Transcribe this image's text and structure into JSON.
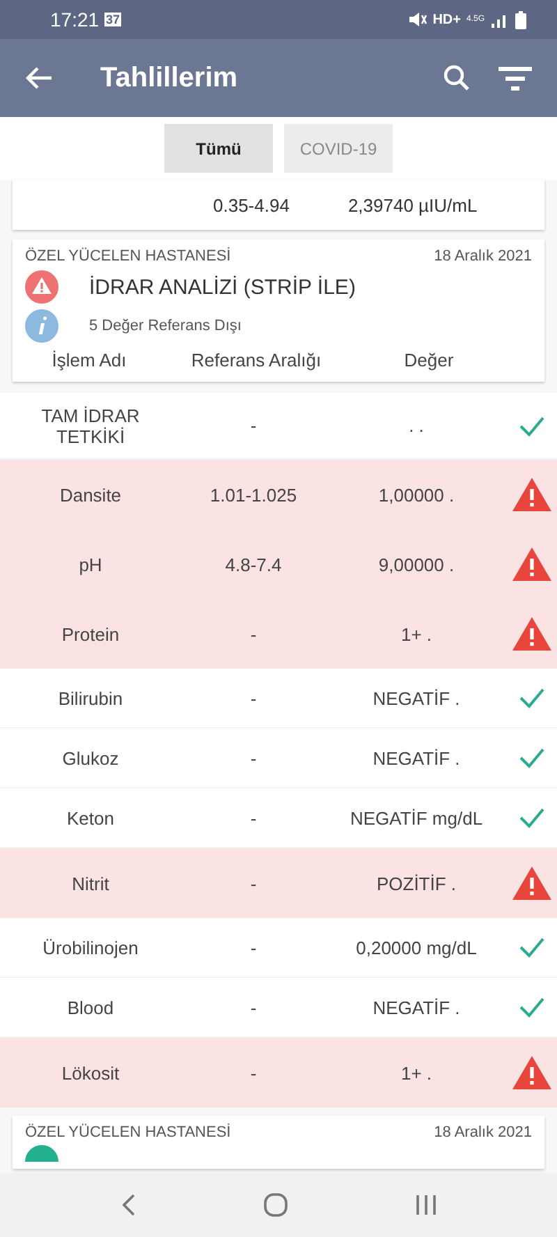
{
  "status_bar": {
    "time": "17:21",
    "calendar_day": "37",
    "network": "HD+",
    "network_type": "4.5G"
  },
  "app_bar": {
    "title": "Tahlillerim"
  },
  "tabs": [
    {
      "label": "Tümü",
      "selected": true
    },
    {
      "label": "COVID-19",
      "selected": false
    }
  ],
  "previous_card": {
    "reference": "0.35-4.94",
    "value": "2,39740 µIU/mL"
  },
  "card": {
    "hospital": "ÖZEL YÜCELEN HASTANESİ",
    "date": "18 Aralık 2021",
    "title": "İDRAR ANALİZİ (STRİP İLE)",
    "note": "5 Değer Referans Dışı",
    "columns": [
      "İşlem Adı",
      "Referans Aralığı",
      "Değer"
    ]
  },
  "rows": [
    {
      "name": "TAM İDRAR TETKİKİ",
      "reference": "-",
      "value": ". .",
      "abnormal": false
    },
    {
      "name": "Dansite",
      "reference": "1.01-1.025",
      "value": "1,00000 .",
      "abnormal": true
    },
    {
      "name": "pH",
      "reference": "4.8-7.4",
      "value": "9,00000 .",
      "abnormal": true
    },
    {
      "name": "Protein",
      "reference": "-",
      "value": "1+ .",
      "abnormal": true
    },
    {
      "name": "Bilirubin",
      "reference": "-",
      "value": "NEGATİF .",
      "abnormal": false
    },
    {
      "name": "Glukoz",
      "reference": "-",
      "value": "NEGATİF .",
      "abnormal": false
    },
    {
      "name": "Keton",
      "reference": "-",
      "value": "NEGATİF mg/dL",
      "abnormal": false
    },
    {
      "name": "Nitrit",
      "reference": "-",
      "value": "POZİTİF .",
      "abnormal": true
    },
    {
      "name": "Ürobilinojen",
      "reference": "-",
      "value": "0,20000 mg/dL",
      "abnormal": false
    },
    {
      "name": "Blood",
      "reference": "-",
      "value": "NEGATİF .",
      "abnormal": false
    },
    {
      "name": "Lökosit",
      "reference": "-",
      "value": "1+ .",
      "abnormal": true
    }
  ],
  "next_card": {
    "hospital": "ÖZEL YÜCELEN HASTANESİ",
    "date": "18 Aralık 2021",
    "abnormal": false
  }
}
